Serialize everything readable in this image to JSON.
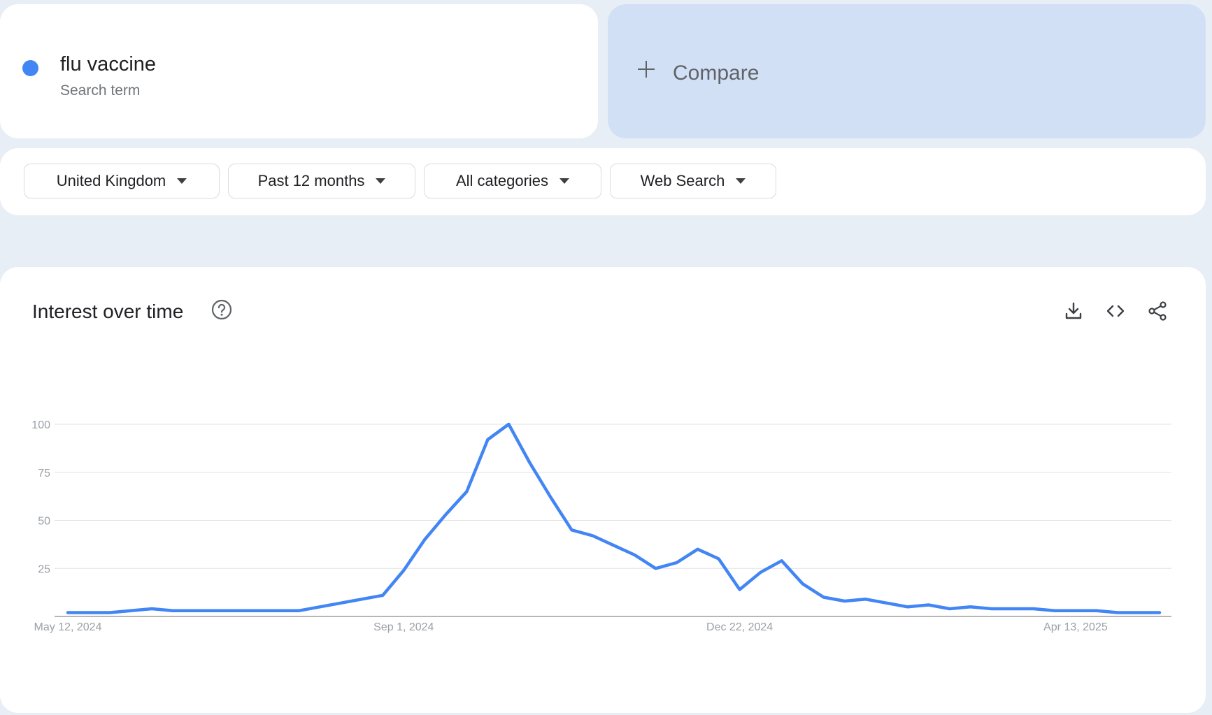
{
  "search_term": {
    "name": "flu vaccine",
    "type_label": "Search term",
    "color": "#4285f4"
  },
  "compare": {
    "label": "Compare",
    "icon": "plus-icon"
  },
  "filters": [
    {
      "label": "United Kingdom"
    },
    {
      "label": "Past 12 months"
    },
    {
      "label": "All categories"
    },
    {
      "label": "Web Search"
    }
  ],
  "chart_panel": {
    "title": "Interest over time",
    "help_icon": "help-icon",
    "actions": [
      "download-icon",
      "embed-icon",
      "share-icon"
    ]
  },
  "chart_data": {
    "type": "line",
    "y_ticks": [
      100,
      75,
      50,
      25
    ],
    "ylim": [
      0,
      100
    ],
    "x_tick_labels": [
      {
        "label": "May 12, 2024",
        "index": 0
      },
      {
        "label": "Sep 1, 2024",
        "index": 16
      },
      {
        "label": "Dec 22, 2024",
        "index": 32
      },
      {
        "label": "Apr 13, 2025",
        "index": 48
      }
    ],
    "grid": true,
    "series": [
      {
        "color": "#4285f4",
        "values": [
          2,
          2,
          2,
          3,
          4,
          3,
          3,
          3,
          3,
          3,
          3,
          3,
          5,
          7,
          9,
          11,
          24,
          40,
          53,
          65,
          92,
          100,
          80,
          62,
          45,
          42,
          37,
          32,
          25,
          28,
          35,
          30,
          14,
          23,
          29,
          17,
          10,
          8,
          9,
          7,
          5,
          6,
          4,
          5,
          4,
          4,
          4,
          3,
          3,
          3,
          2,
          2,
          2
        ]
      }
    ]
  }
}
